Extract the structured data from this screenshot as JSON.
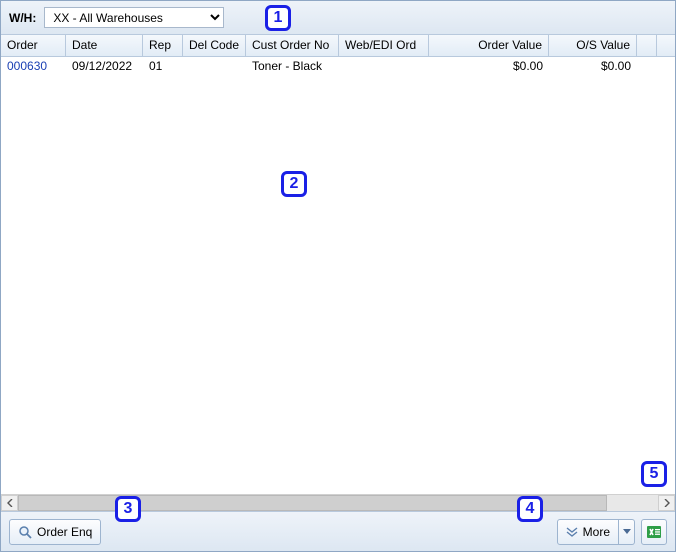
{
  "topbar": {
    "wh_label": "W/H:",
    "wh_value": "XX - All Warehouses"
  },
  "columns": {
    "order": "Order",
    "date": "Date",
    "rep": "Rep",
    "del": "Del Code",
    "cust": "Cust Order No",
    "web": "Web/EDI Ord",
    "val": "Order Value",
    "os": "O/S Value"
  },
  "rows": [
    {
      "order": "000630",
      "date": "09/12/2022",
      "rep": "01",
      "del": "",
      "cust": "Toner - Black",
      "web": "",
      "val": "$0.00",
      "os": "$0.00"
    }
  ],
  "bottom": {
    "order_enq": "Order Enq",
    "more": "More"
  },
  "callouts": {
    "c1": "1",
    "c2": "2",
    "c3": "3",
    "c4": "4",
    "c5": "5"
  }
}
